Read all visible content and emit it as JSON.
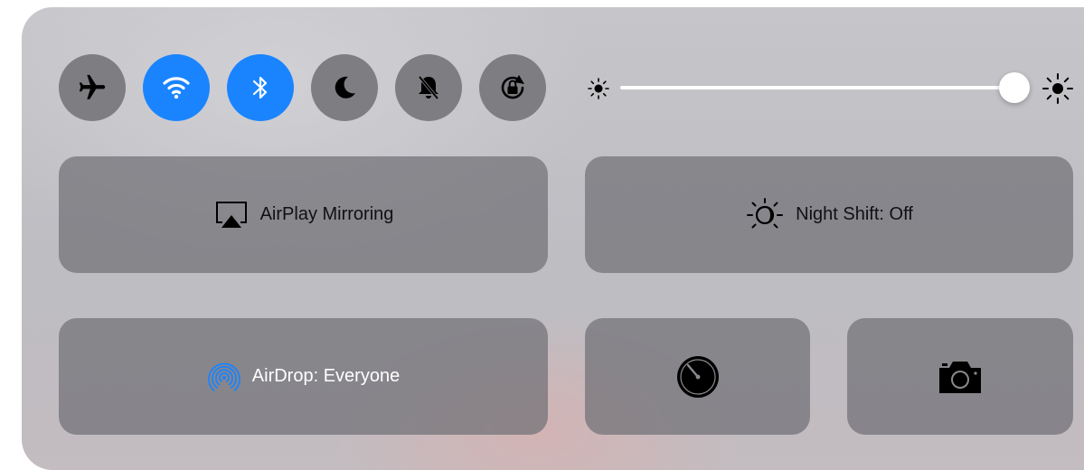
{
  "control_center": {
    "toggles": [
      {
        "name": "Airplane Mode",
        "icon": "airplane-icon",
        "active": false
      },
      {
        "name": "Wi-Fi",
        "icon": "wifi-icon",
        "active": true
      },
      {
        "name": "Bluetooth",
        "icon": "bluetooth-icon",
        "active": true
      },
      {
        "name": "Do Not Disturb",
        "icon": "moon-icon",
        "active": false
      },
      {
        "name": "Silent",
        "icon": "bell-slash-icon",
        "active": false
      },
      {
        "name": "Rotation Lock",
        "icon": "rotation-lock-icon",
        "active": false
      }
    ],
    "brightness": {
      "level": 0.99,
      "min_icon": "sun-small-icon",
      "max_icon": "sun-large-icon"
    },
    "airplay": {
      "label": "AirPlay Mirroring",
      "icon": "airplay-icon"
    },
    "night_shift": {
      "label": "Night Shift: Off",
      "icon": "night-shift-icon"
    },
    "airdrop": {
      "label": "AirDrop: Everyone",
      "icon": "airdrop-icon",
      "icon_color": "#1a84ff"
    },
    "timer": {
      "icon": "timer-icon"
    },
    "camera": {
      "icon": "camera-icon"
    },
    "colors": {
      "active_toggle": "#1a84ff",
      "inactive_toggle": "#7d7d82"
    }
  }
}
